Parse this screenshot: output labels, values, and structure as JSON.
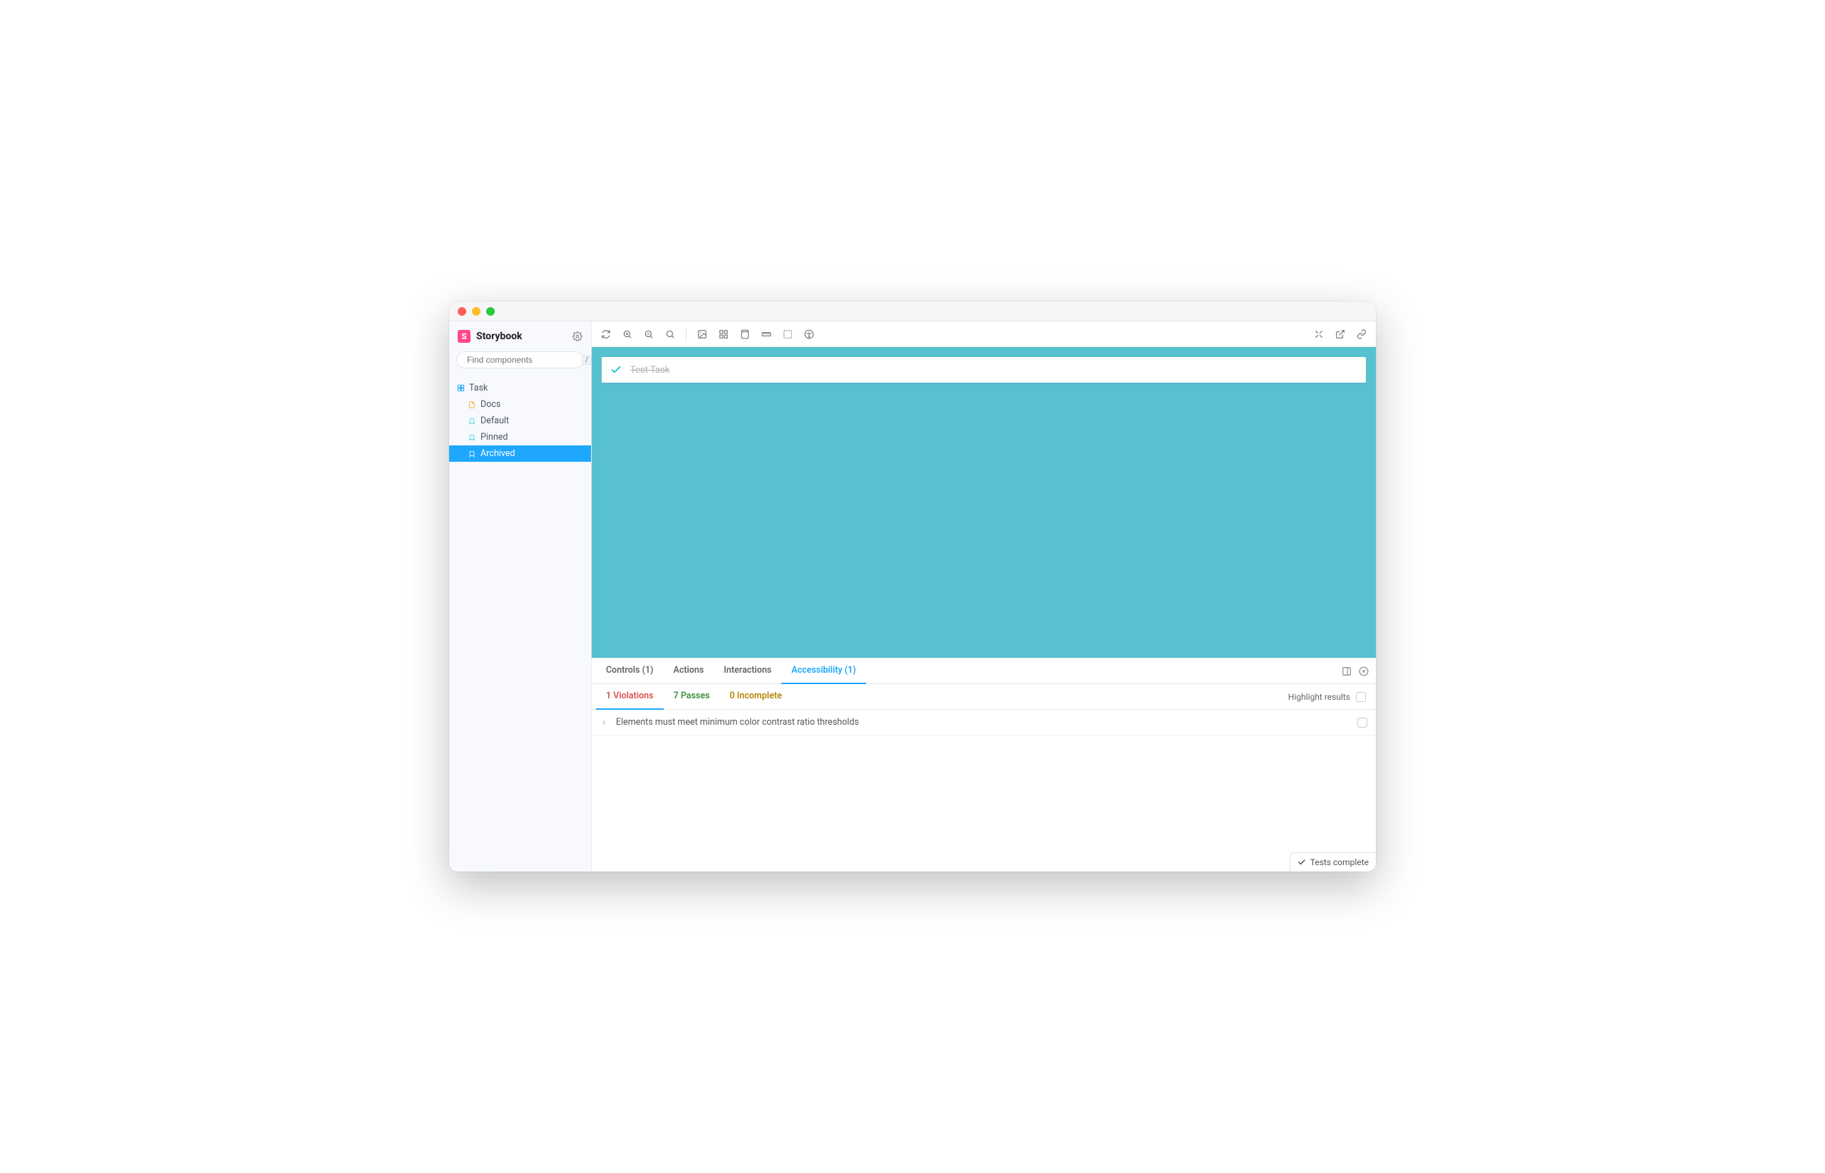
{
  "app": {
    "title": "Storybook"
  },
  "sidebar": {
    "search_placeholder": "Find components",
    "search_shortcut": "/",
    "root": {
      "label": "Task"
    },
    "items": [
      {
        "label": "Docs",
        "kind": "doc",
        "active": false
      },
      {
        "label": "Default",
        "kind": "story",
        "active": false
      },
      {
        "label": "Pinned",
        "kind": "story",
        "active": false
      },
      {
        "label": "Archived",
        "kind": "story",
        "active": true
      }
    ]
  },
  "toolbar_icons": [
    "sync-icon",
    "zoom-in-icon",
    "zoom-out-icon",
    "zoom-reset-icon",
    "image-icon",
    "grid-icon",
    "viewport-icon",
    "ruler-icon",
    "outline-icon",
    "accessibility-icon"
  ],
  "toolbar_right_icons": [
    "fullscreen-icon",
    "open-external-icon",
    "link-icon"
  ],
  "preview": {
    "task_title": "Test Task",
    "bg_color": "#57c1cf"
  },
  "addons": {
    "tabs": [
      {
        "label": "Controls (1)",
        "key": "controls",
        "active": false
      },
      {
        "label": "Actions",
        "key": "actions",
        "active": false
      },
      {
        "label": "Interactions",
        "key": "interactions",
        "active": false
      },
      {
        "label": "Accessibility (1)",
        "key": "accessibility",
        "active": true
      }
    ],
    "panel_right_icons": [
      "panel-position-icon",
      "close-icon"
    ],
    "a11y_tabs": {
      "violations": {
        "label": "1 Violations",
        "active": true
      },
      "passes": {
        "label": "7 Passes",
        "active": false
      },
      "incomplete": {
        "label": "0 Incomplete",
        "active": false
      }
    },
    "highlight_label": "Highlight results",
    "violations": [
      {
        "message": "Elements must meet minimum color contrast ratio thresholds"
      }
    ]
  },
  "status_bar": {
    "label": "Tests complete"
  }
}
